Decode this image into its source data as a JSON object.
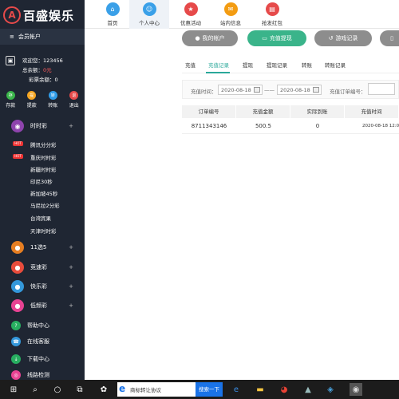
{
  "brand": {
    "name": "百盛娱乐"
  },
  "sidebar": {
    "member_label": "会员帐户",
    "user": {
      "greeting": "欢迎您：123456",
      "balance_label": "总余额：",
      "balance_value": "0元",
      "lottery_label": "彩票余额：0"
    },
    "quick": [
      {
        "label": "存款",
        "icon": "deposit-icon",
        "color": "#3ab54a"
      },
      {
        "label": "提款",
        "icon": "withdraw-icon",
        "color": "#f5a623"
      },
      {
        "label": "转账",
        "icon": "transfer-icon",
        "color": "#2f9be8"
      },
      {
        "label": "退出",
        "icon": "logout-icon",
        "color": "#e64a4a"
      }
    ],
    "categories": [
      {
        "label": "时时彩",
        "color": "#8e44ad"
      },
      {
        "label": "11选5",
        "color": "#e67e22"
      },
      {
        "label": "竞速彩",
        "color": "#e74c3c"
      },
      {
        "label": "快乐彩",
        "color": "#3498db"
      },
      {
        "label": "低频彩",
        "color": "#e84393"
      }
    ],
    "subitems": [
      "腾讯分分彩",
      "重庆时时彩",
      "新疆时时彩",
      "印尼30秒",
      "新加坡45秒",
      "马尼拉2分彩",
      "台湾宾果",
      "天津时时彩"
    ],
    "hot_badge": "HOT",
    "bottom": [
      {
        "label": "帮助中心",
        "color": "#27ae60"
      },
      {
        "label": "在线客服",
        "color": "#3498db"
      },
      {
        "label": "下载中心",
        "color": "#27ae60"
      },
      {
        "label": "线路检测",
        "color": "#e84393"
      }
    ]
  },
  "topnav": [
    {
      "label": "首页",
      "icon": "home-icon",
      "color": "#3aa0e8"
    },
    {
      "label": "个人中心",
      "icon": "user-icon",
      "color": "#3aa0e8"
    },
    {
      "label": "优惠活动",
      "icon": "gift-icon",
      "color": "#e64a4a"
    },
    {
      "label": "站内信息",
      "icon": "message-icon",
      "color": "#f39c12"
    },
    {
      "label": "抢发红包",
      "icon": "redpacket-icon",
      "color": "#e64a4a"
    }
  ],
  "account_buttons": [
    {
      "label": "我的帐户",
      "color": "#8d8d8d"
    },
    {
      "label": "充值提现",
      "color": "#3ab48a"
    },
    {
      "label": "游戏记录",
      "color": "#8d8d8d"
    }
  ],
  "tabs": [
    "充值",
    "充值记录",
    "提现",
    "提现记录",
    "转账",
    "转账记录"
  ],
  "filter": {
    "time_label": "充值时间：",
    "date_from": "2020-08-18",
    "sep": "——",
    "date_to": "2020-08-18",
    "order_label": "充值订单编号："
  },
  "table": {
    "headers": [
      "订单编号",
      "充值金额",
      "实际到账",
      "充值时间"
    ],
    "rows": [
      [
        "8711343146",
        "500.5",
        "0",
        "2020-08-18 12:01"
      ]
    ]
  },
  "taskbar": {
    "search_text": "商标转让协议",
    "search_button": "搜索一下"
  }
}
